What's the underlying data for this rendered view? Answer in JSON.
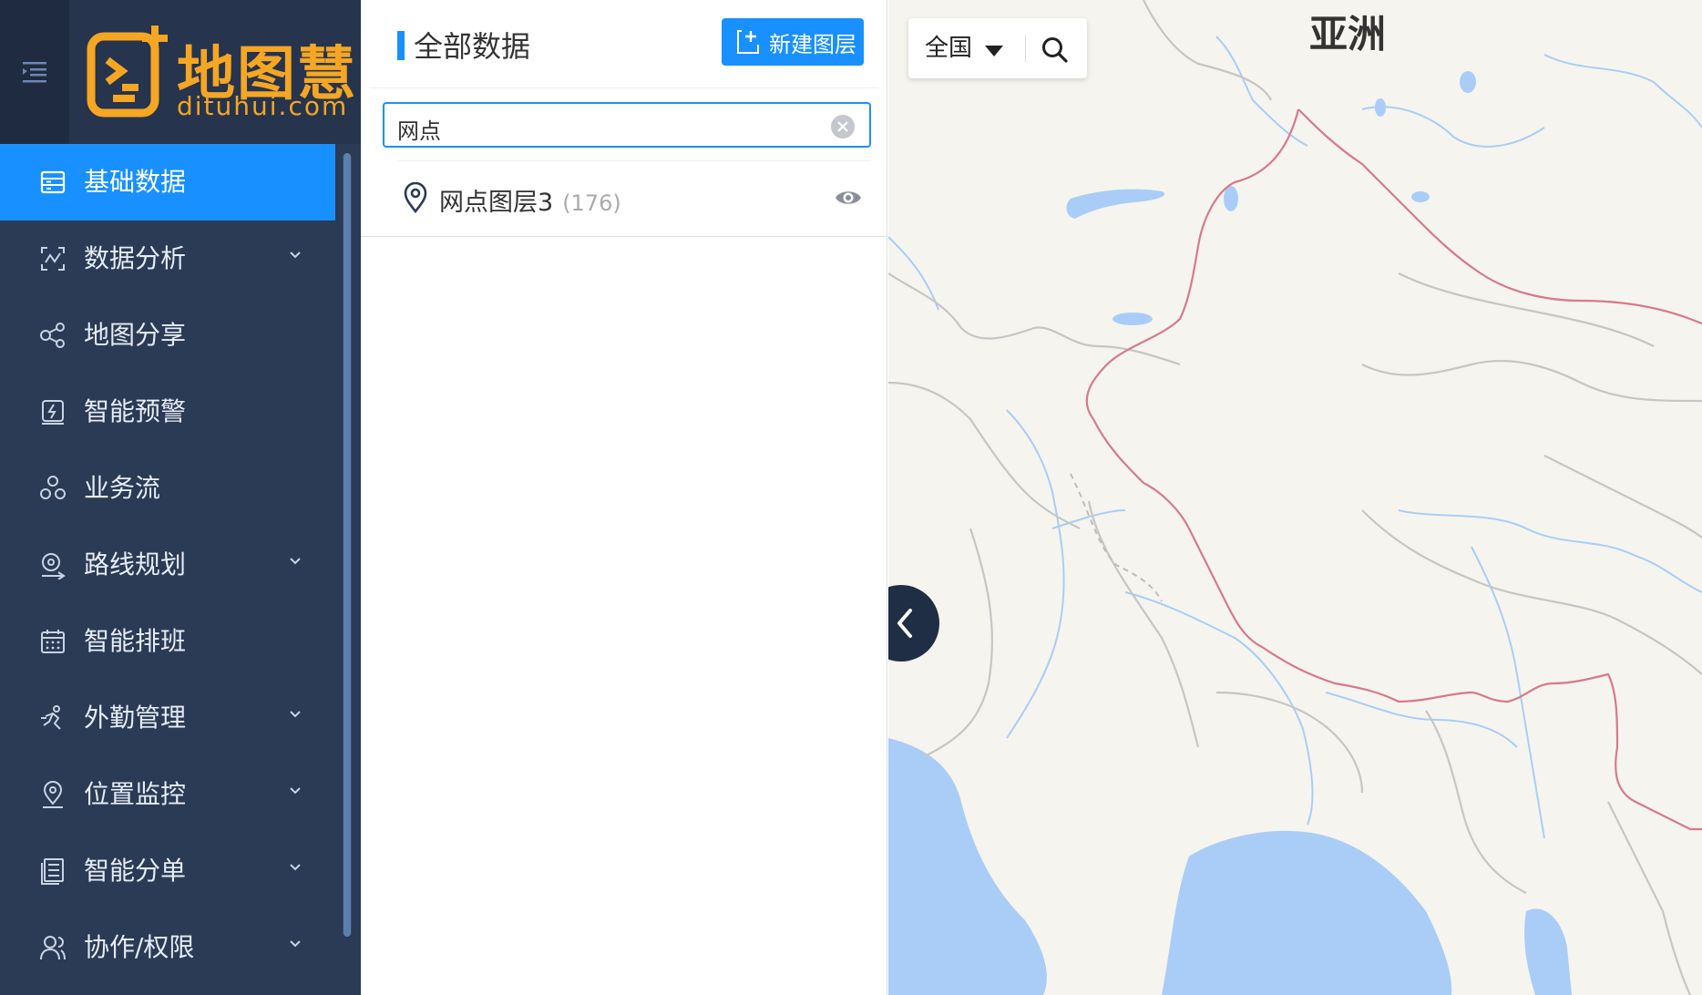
{
  "brand": {
    "name": "地图慧",
    "domain": "dituhui.com",
    "color": "#f5a623"
  },
  "sidebar": {
    "collapse_icon": "menu-fold-icon",
    "items": [
      {
        "label": "基础数据",
        "icon": "database-icon",
        "active": true,
        "has_children": false
      },
      {
        "label": "数据分析",
        "icon": "analytics-icon",
        "active": false,
        "has_children": true
      },
      {
        "label": "地图分享",
        "icon": "share-icon",
        "active": false,
        "has_children": false
      },
      {
        "label": "智能预警",
        "icon": "alert-icon",
        "active": false,
        "has_children": false
      },
      {
        "label": "业务流",
        "icon": "workflow-icon",
        "active": false,
        "has_children": false
      },
      {
        "label": "路线规划",
        "icon": "route-icon",
        "active": false,
        "has_children": true
      },
      {
        "label": "智能排班",
        "icon": "calendar-icon",
        "active": false,
        "has_children": false
      },
      {
        "label": "外勤管理",
        "icon": "field-staff-icon",
        "active": false,
        "has_children": true
      },
      {
        "label": "位置监控",
        "icon": "location-monitor-icon",
        "active": false,
        "has_children": true
      },
      {
        "label": "智能分单",
        "icon": "order-dispatch-icon",
        "active": false,
        "has_children": true
      },
      {
        "label": "协作/权限",
        "icon": "user-icon",
        "active": false,
        "has_children": true
      }
    ]
  },
  "panel": {
    "title": "全部数据",
    "new_layer_label": "新建图层",
    "search_value": "网点",
    "layers": [
      {
        "name": "网点图层3",
        "count": "(176)",
        "visible": true
      }
    ]
  },
  "map": {
    "region_label": "全国",
    "continent_label": "亚洲",
    "colors": {
      "land": "#f6f4ee",
      "water": "#a9cdf7",
      "country_border": "#c6c6c6",
      "china_border": "#d67a8a",
      "accent": "#1890ff",
      "sidebar_bg": "#2b3a55"
    }
  }
}
